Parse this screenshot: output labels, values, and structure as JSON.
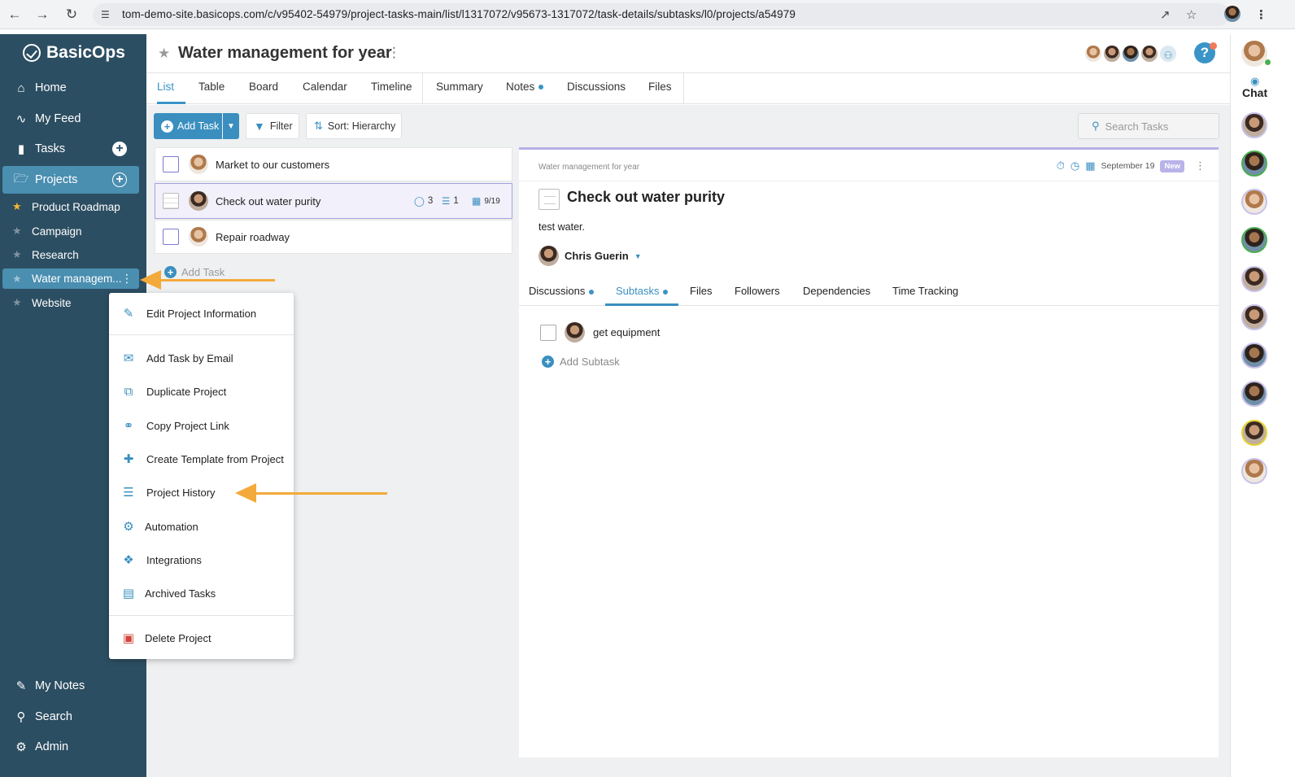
{
  "browser": {
    "url": "tom-demo-site.basicops.com/c/v95402-54979/project-tasks-main/list/l1317072/v95673-1317072/task-details/subtasks/l0/projects/a54979"
  },
  "sidebar": {
    "logo": "BasicOps",
    "nav": [
      {
        "label": "Home",
        "icon": "home-icon"
      },
      {
        "label": "My Feed",
        "icon": "pulse-icon"
      },
      {
        "label": "Tasks",
        "icon": "clipboard-icon"
      },
      {
        "label": "Projects",
        "icon": "folder-icon"
      }
    ],
    "projects": [
      {
        "label": "Product Roadmap",
        "favorite": true
      },
      {
        "label": "Campaign",
        "favorite": false
      },
      {
        "label": "Research",
        "favorite": false
      },
      {
        "label": "Water managem...",
        "favorite": false
      },
      {
        "label": "Website",
        "favorite": false
      }
    ],
    "bottom": [
      {
        "label": "My Notes",
        "icon": "pencil-icon"
      },
      {
        "label": "Search",
        "icon": "search-icon"
      },
      {
        "label": "Admin",
        "icon": "gear-icon"
      }
    ]
  },
  "header": {
    "title": "Water management for year"
  },
  "tabs": [
    "List",
    "Table",
    "Board",
    "Calendar",
    "Timeline",
    "Summary",
    "Notes",
    "Discussions",
    "Files"
  ],
  "toolbar": {
    "add_task": "Add Task",
    "filter": "Filter",
    "sort": "Sort: Hierarchy",
    "search_placeholder": "Search Tasks"
  },
  "tasks": [
    {
      "title": "Market to our customers"
    },
    {
      "title": "Check out water purity",
      "comments": "3",
      "subtasks": "1",
      "date": "9/19"
    },
    {
      "title": "Repair roadway"
    }
  ],
  "add_task_link": "Add Task",
  "detail": {
    "breadcrumb": "Water management for year",
    "date": "September 19",
    "badge": "New",
    "title": "Check out water purity",
    "description": "test water.",
    "assignee": "Chris Guerin",
    "tabs": [
      "Discussions",
      "Subtasks",
      "Files",
      "Followers",
      "Dependencies",
      "Time Tracking"
    ],
    "subtask": "get equipment",
    "add_subtask": "Add Subtask"
  },
  "context_menu": [
    {
      "label": "Edit Project Information",
      "icon": "edit-icon"
    },
    {
      "label": "Add Task by Email",
      "icon": "email-icon"
    },
    {
      "label": "Duplicate Project",
      "icon": "copy-icon"
    },
    {
      "label": "Copy Project Link",
      "icon": "link-icon"
    },
    {
      "label": "Create Template from Project",
      "icon": "template-icon"
    },
    {
      "label": "Project History",
      "icon": "list-icon"
    },
    {
      "label": "Automation",
      "icon": "cogs-icon"
    },
    {
      "label": "Integrations",
      "icon": "puzzle-icon"
    },
    {
      "label": "Archived Tasks",
      "icon": "archive-icon"
    },
    {
      "label": "Delete Project",
      "icon": "trash-icon"
    }
  ],
  "chat": {
    "label": "Chat"
  },
  "colors": {
    "sidebar": "#2c4e62",
    "accent": "#3a8fbf",
    "arrow": "#f4a93b",
    "selected": "#4a8eb0"
  }
}
